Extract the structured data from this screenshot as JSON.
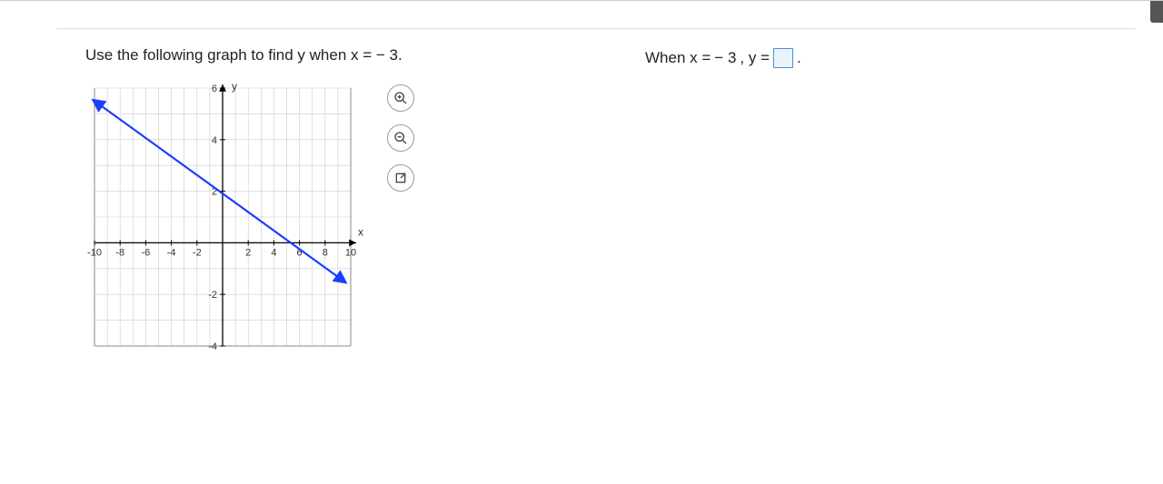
{
  "question": {
    "prompt_prefix": "Use the following graph to find y when x = ",
    "x_value": "− 3",
    "prompt_suffix": "."
  },
  "answer": {
    "prefix": "When x = ",
    "x_value": "− 3",
    "mid": ", y = ",
    "suffix": "."
  },
  "tools": {
    "zoom_in": "zoom-in",
    "zoom_out": "zoom-out",
    "expand": "expand"
  },
  "chart_data": {
    "type": "line",
    "title": "",
    "xlabel": "x",
    "ylabel": "y",
    "xlim": [
      -10,
      10
    ],
    "ylim": [
      -4,
      6
    ],
    "x_ticks": [
      -10,
      -8,
      -6,
      -4,
      -2,
      2,
      4,
      6,
      8,
      10
    ],
    "y_ticks": [
      -4,
      -2,
      2,
      4,
      6
    ],
    "series": [
      {
        "name": "line",
        "color": "#1a3fff",
        "points": [
          {
            "x": -10,
            "y": 5.5
          },
          {
            "x": 9.5,
            "y": -1.5
          }
        ],
        "slope": -0.359,
        "intercept": 1.91,
        "arrows": "both"
      }
    ],
    "grid": true
  }
}
